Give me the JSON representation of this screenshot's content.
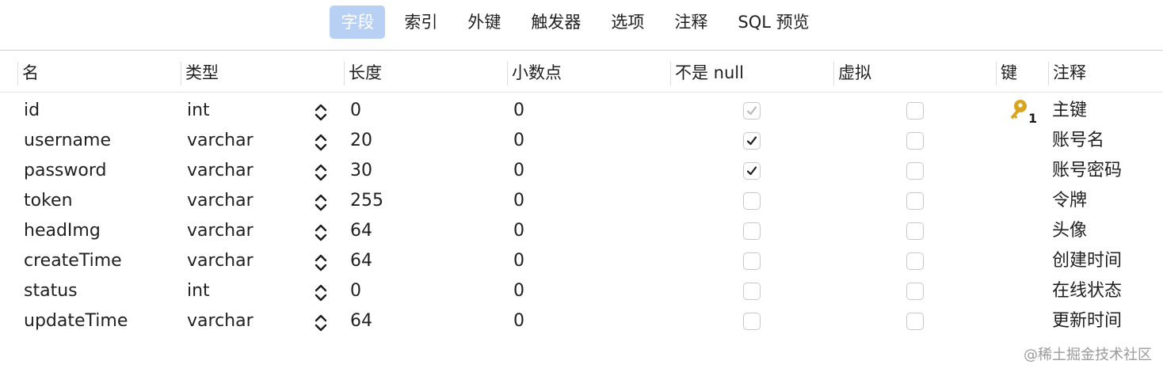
{
  "tabs": [
    {
      "label": "字段",
      "active": true
    },
    {
      "label": "索引",
      "active": false
    },
    {
      "label": "外键",
      "active": false
    },
    {
      "label": "触发器",
      "active": false
    },
    {
      "label": "选项",
      "active": false
    },
    {
      "label": "注释",
      "active": false
    },
    {
      "label": "SQL 预览",
      "active": false
    }
  ],
  "columns": {
    "name": "名",
    "type": "类型",
    "length": "长度",
    "decimals": "小数点",
    "not_null": "不是 null",
    "virtual": "虚拟",
    "key": "键",
    "comment": "注释"
  },
  "rows": [
    {
      "name": "id",
      "type": "int",
      "length": "0",
      "decimals": "0",
      "not_null": true,
      "not_null_disabled": true,
      "virtual": false,
      "key": true,
      "key_index": "1",
      "comment": "主键"
    },
    {
      "name": "username",
      "type": "varchar",
      "length": "20",
      "decimals": "0",
      "not_null": true,
      "not_null_disabled": false,
      "virtual": false,
      "key": false,
      "key_index": "",
      "comment": "账号名"
    },
    {
      "name": "password",
      "type": "varchar",
      "length": "30",
      "decimals": "0",
      "not_null": true,
      "not_null_disabled": false,
      "virtual": false,
      "key": false,
      "key_index": "",
      "comment": "账号密码"
    },
    {
      "name": "token",
      "type": "varchar",
      "length": "255",
      "decimals": "0",
      "not_null": false,
      "not_null_disabled": false,
      "virtual": false,
      "key": false,
      "key_index": "",
      "comment": "令牌"
    },
    {
      "name": "headImg",
      "type": "varchar",
      "length": "64",
      "decimals": "0",
      "not_null": false,
      "not_null_disabled": false,
      "virtual": false,
      "key": false,
      "key_index": "",
      "comment": "头像"
    },
    {
      "name": "createTime",
      "type": "varchar",
      "length": "64",
      "decimals": "0",
      "not_null": false,
      "not_null_disabled": false,
      "virtual": false,
      "key": false,
      "key_index": "",
      "comment": "创建时间"
    },
    {
      "name": "status",
      "type": "int",
      "length": "0",
      "decimals": "0",
      "not_null": false,
      "not_null_disabled": false,
      "virtual": false,
      "key": false,
      "key_index": "",
      "comment": "在线状态"
    },
    {
      "name": "updateTime",
      "type": "varchar",
      "length": "64",
      "decimals": "0",
      "not_null": false,
      "not_null_disabled": false,
      "virtual": false,
      "key": false,
      "key_index": "",
      "comment": "更新时间"
    }
  ],
  "watermark": "@稀土掘金技术社区",
  "icons": {
    "key": "key-icon",
    "stepper": "chevron-up-down-icon",
    "check": "checkmark-icon"
  },
  "colors": {
    "active_tab_bg": "#b9d0f5",
    "active_tab_text": "#ffffff",
    "key_gold": "#d9a521"
  }
}
